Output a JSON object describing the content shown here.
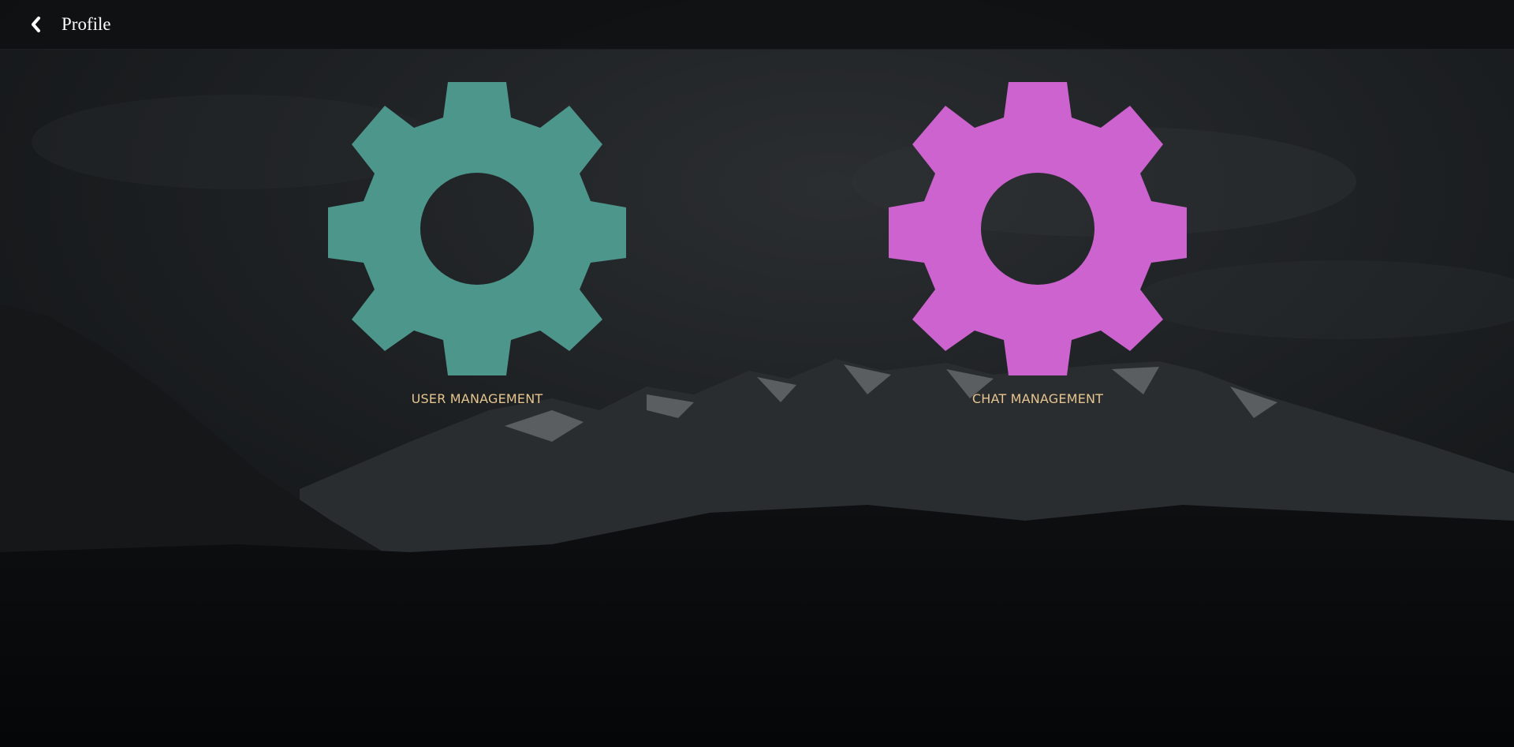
{
  "header": {
    "back_icon": "chevron-left-icon",
    "title": "Profile"
  },
  "tiles": [
    {
      "icon": "gear-icon",
      "color": "#4d968c",
      "label": "USER MANAGEMENT"
    },
    {
      "icon": "gear-icon",
      "color": "#cc63cf",
      "label": "CHAT MANAGEMENT"
    }
  ],
  "colors": {
    "background": "#0b0d0f",
    "label_text": "#e6c58f",
    "title_text": "#ffffff"
  }
}
